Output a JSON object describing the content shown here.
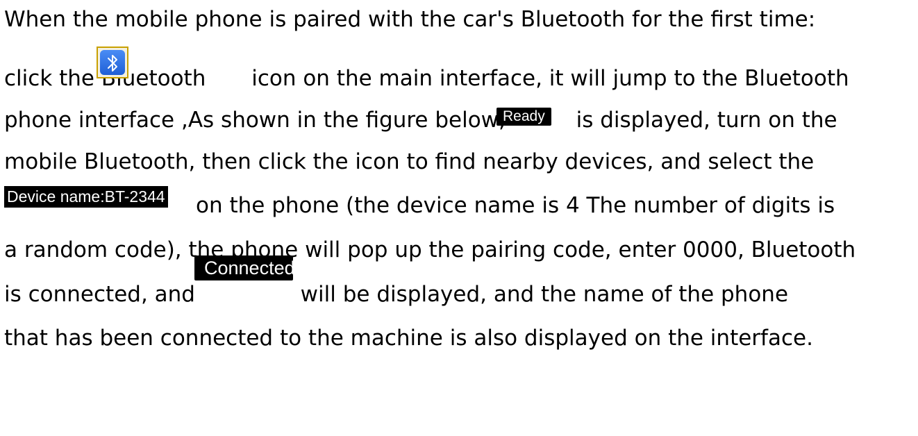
{
  "document": {
    "line1": "  When the mobile phone is paired with the car's Bluetooth for the first time:",
    "line2a": "click the Bluetooth ",
    "line2b": "icon on the main interface, it will jump to the Bluetooth",
    "line3a": "phone interface ,As shown in the figure below, ",
    "line3b": " is displayed, turn on the",
    "line4": "mobile Bluetooth, then click the icon to find nearby devices, and select the",
    "line5b": "on the phone (the device name is 4 The number of digits is",
    "line6": "a random code), the phone will pop up the pairing code, enter 0000, Bluetooth",
    "line7a": "is connected, and ",
    "line7b": " will be displayed, and the name of the phone",
    "line8": "that has been connected to the machine is also displayed on the interface."
  },
  "images": {
    "bluetooth_icon": "bluetooth-icon",
    "ready_label": "Ready",
    "device_name_label": "Device name:BT-2344",
    "connected_label": "Connected"
  },
  "colors": {
    "icon_blue": "#2f74e8",
    "label_background": "#000000",
    "label_text": "#ffffff"
  }
}
